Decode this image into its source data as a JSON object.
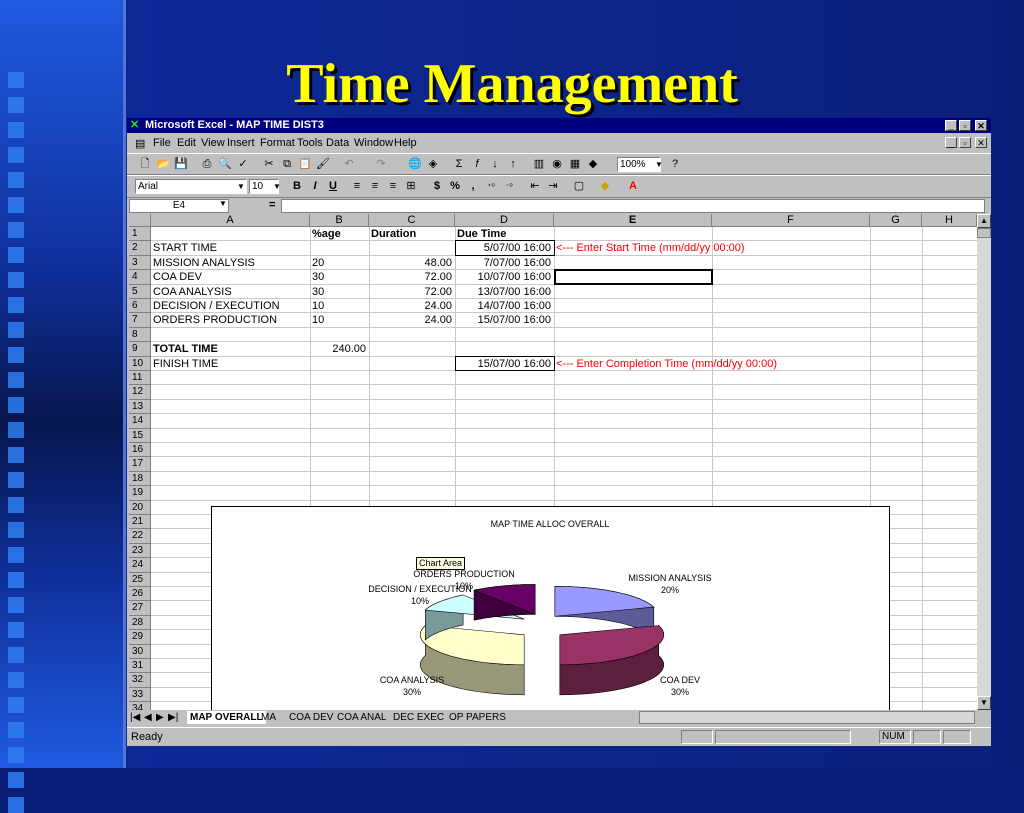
{
  "slide": {
    "title": "Time Management"
  },
  "window": {
    "title": "Microsoft Excel - MAP TIME DIST3"
  },
  "menu": [
    "File",
    "Edit",
    "View",
    "Insert",
    "Format",
    "Tools",
    "Data",
    "Window",
    "Help"
  ],
  "toolbar": {
    "zoom": "100%",
    "font": "Arial",
    "size": "10",
    "bold": "B",
    "italic": "I",
    "underline": "U",
    "currency": "$",
    "percent": "%",
    "comma": ","
  },
  "formula_bar": {
    "name_box": "E4",
    "equals": "="
  },
  "columns": [
    "A",
    "B",
    "C",
    "D",
    "E",
    "F",
    "G",
    "H"
  ],
  "rows": [
    "1",
    "2",
    "3",
    "4",
    "5",
    "6",
    "7",
    "8",
    "9",
    "10",
    "11",
    "12",
    "13",
    "14",
    "15",
    "16",
    "17",
    "18",
    "19",
    "20",
    "21",
    "22",
    "23",
    "24",
    "25",
    "26",
    "27",
    "28",
    "29",
    "30",
    "31",
    "32",
    "33",
    "34"
  ],
  "sheet": {
    "headers": {
      "b": "%age",
      "c": "Duration",
      "d": "Due Time"
    },
    "r2": {
      "a": "START TIME",
      "d": "5/07/00 16:00",
      "e": "<--- Enter Start Time (mm/dd/yy 00:00)"
    },
    "r3": {
      "a": "MISSION ANALYSIS",
      "b": "20",
      "c": "48.00",
      "d": "7/07/00 16:00"
    },
    "r4": {
      "a": "COA DEV",
      "b": "30",
      "c": "72.00",
      "d": "10/07/00 16:00"
    },
    "r5": {
      "a": "COA ANALYSIS",
      "b": "30",
      "c": "72.00",
      "d": "13/07/00 16:00"
    },
    "r6": {
      "a": "DECISION / EXECUTION",
      "b": "10",
      "c": "24.00",
      "d": "14/07/00 16:00"
    },
    "r7": {
      "a": "ORDERS PRODUCTION",
      "b": "10",
      "c": "24.00",
      "d": "15/07/00 16:00"
    },
    "r9": {
      "a": "TOTAL TIME",
      "b": "240.00"
    },
    "r10": {
      "a": "FINISH TIME",
      "d": "15/07/00 16:00",
      "e": "<--- Enter Completion Time (mm/dd/yy 00:00)"
    }
  },
  "chart_data": {
    "type": "pie",
    "title": "MAP TIME ALLOC OVERALL",
    "categories": [
      "MISSION ANALYSIS",
      "COA DEV",
      "COA ANALYSIS",
      "DECISION / EXECUTION",
      "ORDERS PRODUCTION"
    ],
    "values": [
      20,
      30,
      30,
      10,
      10
    ],
    "labels": [
      "20%",
      "30%",
      "30%",
      "10%",
      "10%"
    ],
    "colors": [
      "#9999ff",
      "#993366",
      "#ffffcc",
      "#ccffff",
      "#660066"
    ],
    "tooltip": "Chart Area"
  },
  "sheet_tabs": [
    "MAP OVERALL",
    "MA",
    "COA DEV",
    "COA ANAL",
    "DEC  EXEC",
    "OP PAPERS"
  ],
  "status": {
    "left": "Ready",
    "num": "NUM"
  }
}
